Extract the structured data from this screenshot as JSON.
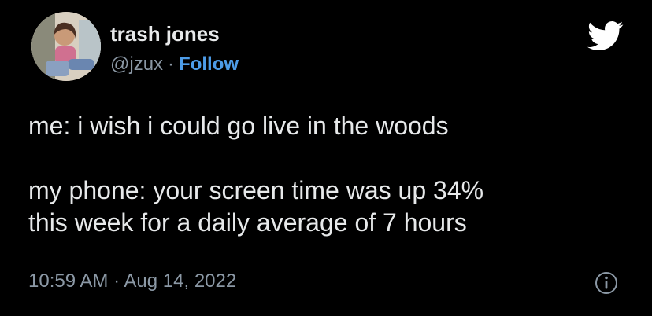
{
  "author": {
    "display_name": "trash jones",
    "handle": "@jzux",
    "separator": "·",
    "follow_label": "Follow"
  },
  "tweet": {
    "line1": "me: i wish i could go live in the woods",
    "line2": "my phone: your screen time was up 34%",
    "line3": "this week for a daily average of 7 hours"
  },
  "meta": {
    "time": "10:59 AM",
    "separator": "·",
    "date": "Aug 14, 2022"
  },
  "icons": {
    "brand": "twitter-bird-icon",
    "info": "info-icon"
  },
  "colors": {
    "background": "#000000",
    "text": "#e7e9ea",
    "secondary": "#8b98a5",
    "accent": "#4d9ce8"
  }
}
